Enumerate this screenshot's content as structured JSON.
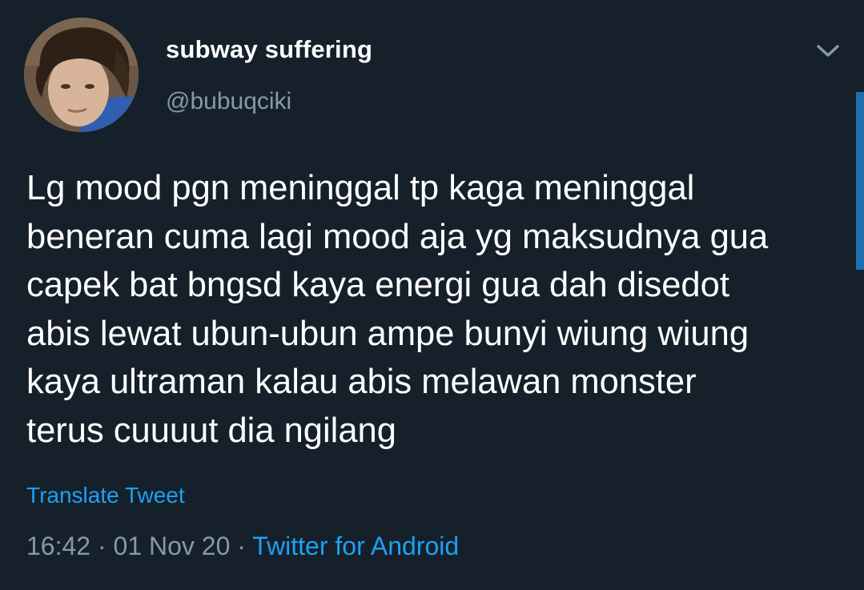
{
  "user": {
    "display_name": "subway suffering",
    "handle": "@bubuqciki"
  },
  "tweet": {
    "lines": [
      "Lg mood pgn meninggal tp kaga meninggal",
      "beneran cuma lagi mood aja yg maksudnya gua",
      "capek bat bngsd kaya energi gua dah disedot",
      "abis lewat ubun-ubun ampe bunyi wiung wiung",
      "kaya ultraman kalau abis melawan monster",
      "terus cuuuut dia ngilang"
    ],
    "translate_label": "Translate Tweet",
    "time": "16:42",
    "separator": "·",
    "date": "01 Nov 20",
    "source": "Twitter for Android"
  },
  "icons": {
    "menu": "chevron-down-icon",
    "avatar": "avatar"
  },
  "colors": {
    "background": "#15202b",
    "text": "#ffffff",
    "secondary": "#8899a6",
    "accent": "#1da1f2"
  }
}
